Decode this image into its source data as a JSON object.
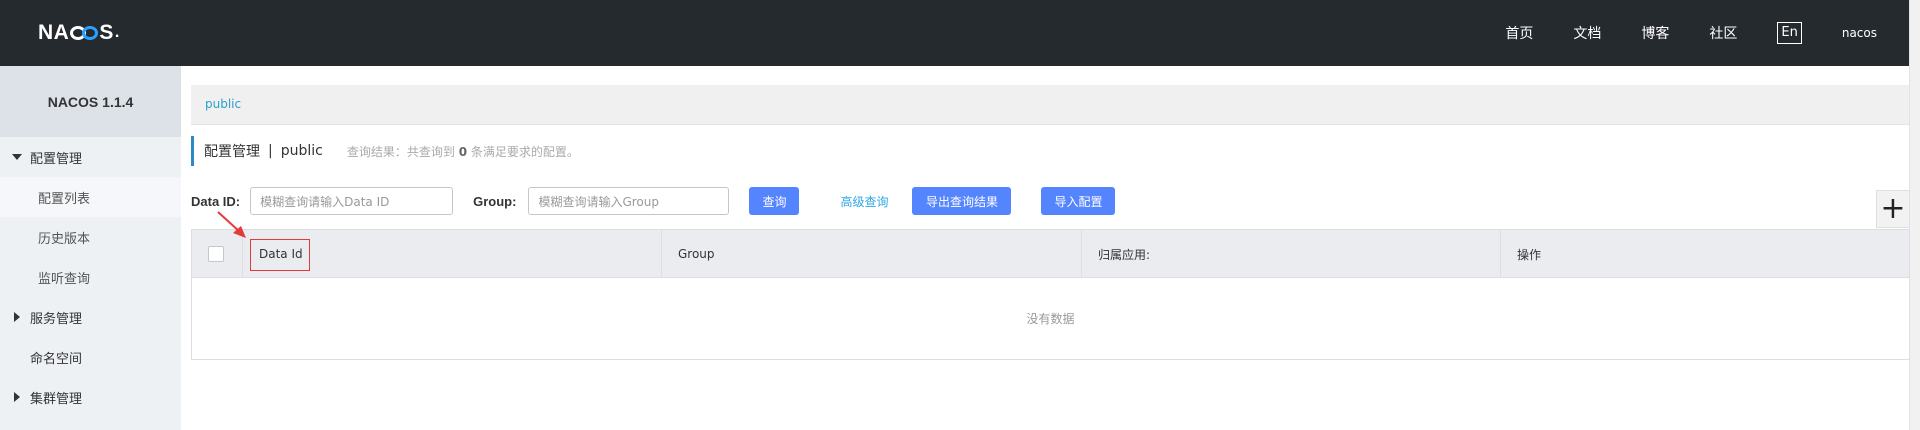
{
  "header": {
    "logo": {
      "part1": "NA",
      "part2": "S",
      "dot": "."
    },
    "nav": [
      "首页",
      "文档",
      "博客",
      "社区"
    ],
    "lang": "En",
    "user": "nacos"
  },
  "sidebar": {
    "title": "NACOS 1.1.4",
    "items": [
      {
        "label": "配置管理"
      },
      {
        "label": "配置列表"
      },
      {
        "label": "历史版本"
      },
      {
        "label": "监听查询"
      },
      {
        "label": "服务管理"
      },
      {
        "label": "命名空间"
      },
      {
        "label": "集群管理"
      }
    ]
  },
  "breadcrumb": {
    "namespace": "public"
  },
  "page": {
    "title": "配置管理",
    "separator": "|",
    "namespace": "public",
    "query_note_prefix": "查询结果：共查询到",
    "query_count": "0",
    "query_note_suffix": "条满足要求的配置。"
  },
  "filters": {
    "data_id_label": "Data ID:",
    "data_id_placeholder": "模糊查询请输入Data ID",
    "group_label": "Group:",
    "group_placeholder": "模糊查询请输入Group",
    "search_button": "查询",
    "advanced_link": "高级查询",
    "export_button": "导出查询结果",
    "import_button": "导入配置",
    "add_symbol": "+"
  },
  "table": {
    "columns": [
      "Data Id",
      "Group",
      "归属应用:",
      "操作"
    ],
    "empty_text": "没有数据"
  },
  "colors": {
    "header_bg": "#252a2f",
    "primary_button": "#5584ff",
    "link": "#2fa6e8",
    "annotation_red": "#e43a3a"
  }
}
